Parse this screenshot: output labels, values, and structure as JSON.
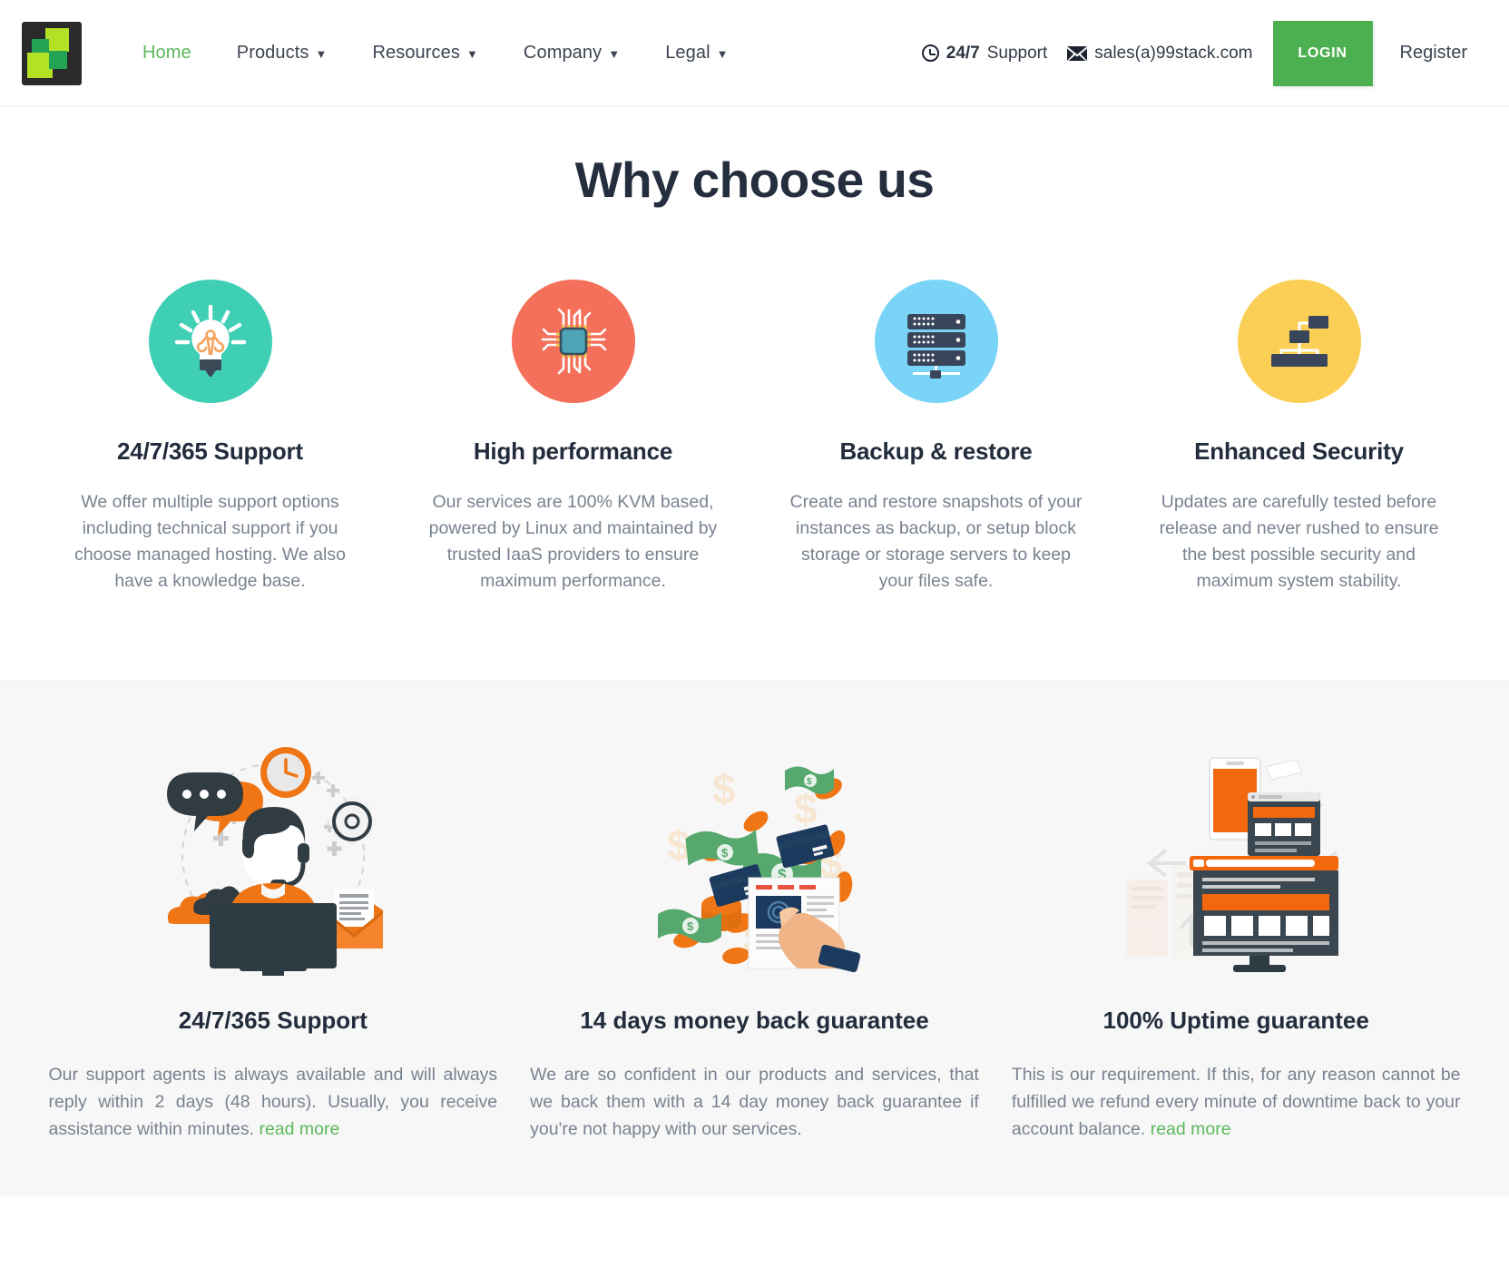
{
  "header": {
    "logo_alt": "99stack logo",
    "nav": [
      {
        "label": "Home",
        "has_caret": false,
        "active": true
      },
      {
        "label": "Products",
        "has_caret": true,
        "active": false
      },
      {
        "label": "Resources",
        "has_caret": true,
        "active": false
      },
      {
        "label": "Company",
        "has_caret": true,
        "active": false
      },
      {
        "label": "Legal",
        "has_caret": true,
        "active": false
      }
    ],
    "support_bold": "24/7",
    "support_label": "Support",
    "email": "sales(a)99stack.com",
    "login_label": "LOGIN",
    "register_label": "Register",
    "accent_green": "#4caf50",
    "link_green": "#5cb85c"
  },
  "why": {
    "title": "Why choose us",
    "features": [
      {
        "icon": "lightbulb-icon",
        "circle_color": "#3fcfb5",
        "title": "24/7/365 Support",
        "text": "We offer multiple support options including technical support if you choose managed hosting. We also have a knowledge base."
      },
      {
        "icon": "cpu-chip-icon",
        "circle_color": "#f4705a",
        "title": "High performance",
        "text": "Our services are 100% KVM based, powered by Linux and maintained by trusted IaaS providers to ensure maximum performance."
      },
      {
        "icon": "server-rack-icon",
        "circle_color": "#79d4f7",
        "title": "Backup & restore",
        "text": "Create and restore snapshots of your instances as backup, or setup block storage or storage servers to keep your files safe."
      },
      {
        "icon": "network-tree-icon",
        "circle_color": "#fbcf55",
        "title": "Enhanced Security",
        "text": "Updates are carefully tested before release and never rushed to ensure the best possible security and maximum system stability."
      }
    ]
  },
  "guarantees": {
    "background": "#f7f7f7",
    "items": [
      {
        "illustration": "support-agent-illustration",
        "title": "24/7/365 Support",
        "text": "Our support agents is always available and will always reply within 2 days (48 hours). Usually, you receive assistance within minutes.",
        "read_more": "read more",
        "has_read_more": true
      },
      {
        "illustration": "money-back-illustration",
        "title": "14 days money back guarantee",
        "text": "We are so confident in our products and services, that we back them with a 14 day money back guarantee if you're not happy with our services.",
        "read_more": "",
        "has_read_more": false
      },
      {
        "illustration": "responsive-devices-illustration",
        "title": "100% Uptime guarantee",
        "text": "This is our requirement. If this, for any reason cannot be fulfilled we refund every minute of downtime back to your account balance.",
        "read_more": "read more",
        "has_read_more": true
      }
    ]
  }
}
